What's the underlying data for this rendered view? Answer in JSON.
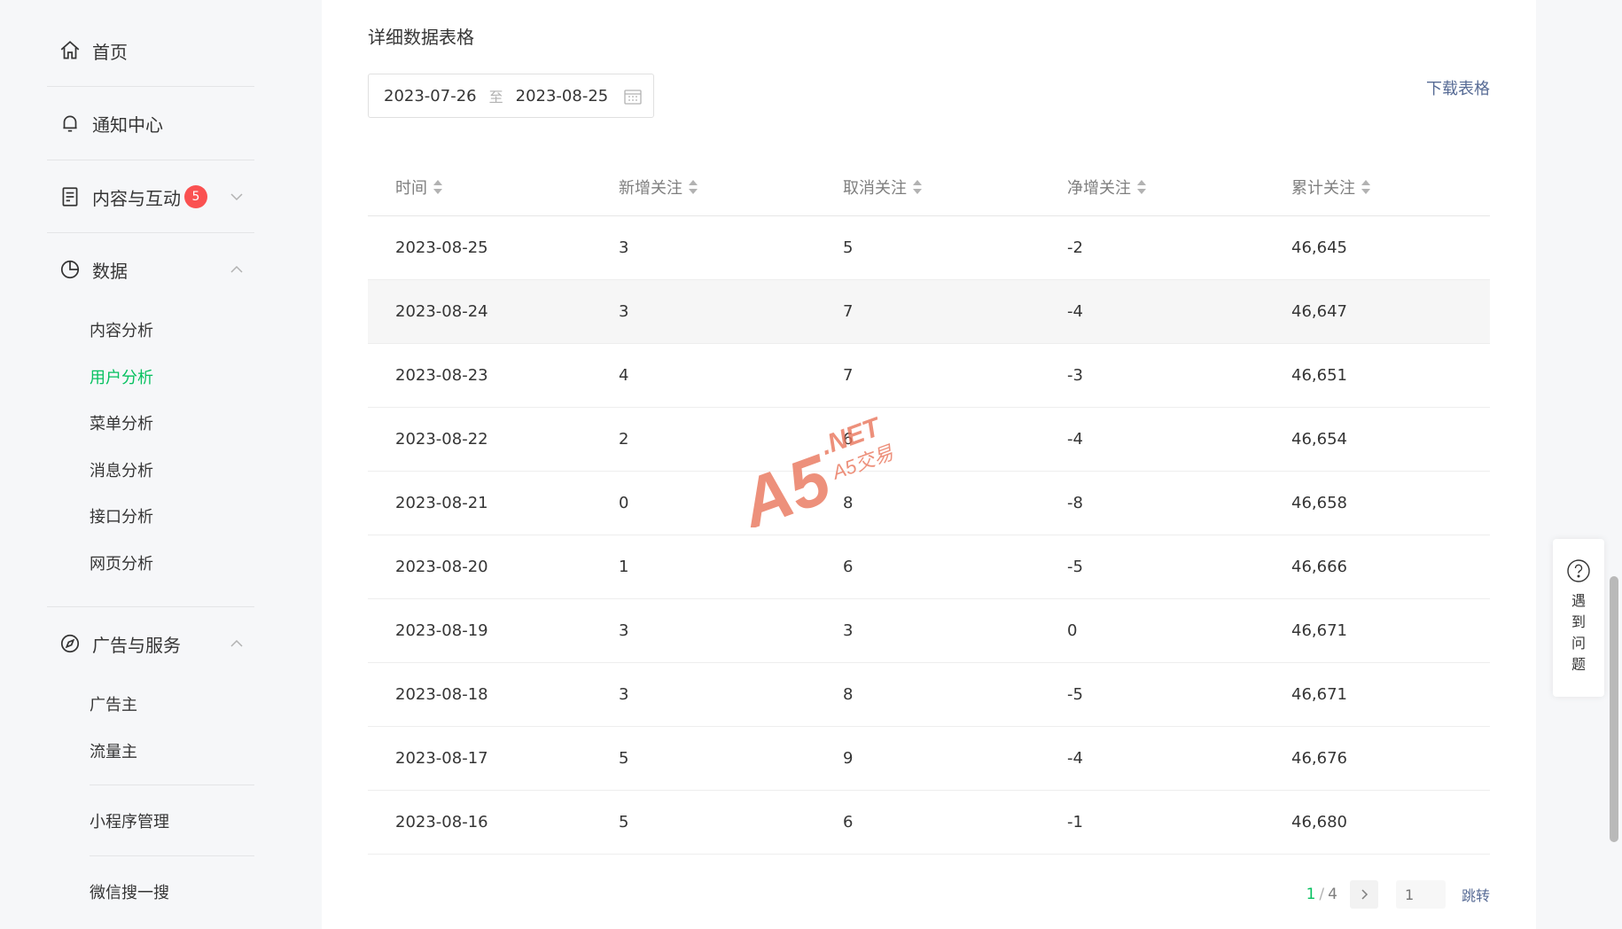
{
  "sidebar": {
    "home": "首页",
    "notifications": "通知中心",
    "content": {
      "label": "内容与互动",
      "badge": "5"
    },
    "data": {
      "label": "数据",
      "children": [
        "内容分析",
        "用户分析",
        "菜单分析",
        "消息分析",
        "接口分析",
        "网页分析"
      ]
    },
    "ads": {
      "label": "广告与服务",
      "children": [
        "广告主",
        "流量主"
      ]
    },
    "mini_program": "小程序管理",
    "wechat_search": "微信搜一搜"
  },
  "main": {
    "section_title": "详细数据表格",
    "date_range": {
      "start": "2023-07-26",
      "separator": "至",
      "end": "2023-08-25"
    },
    "download_label": "下载表格",
    "table": {
      "headers": [
        "时间",
        "新增关注",
        "取消关注",
        "净增关注",
        "累计关注"
      ],
      "rows": [
        [
          "2023-08-25",
          "3",
          "5",
          "-2",
          "46,645"
        ],
        [
          "2023-08-24",
          "3",
          "7",
          "-4",
          "46,647"
        ],
        [
          "2023-08-23",
          "4",
          "7",
          "-3",
          "46,651"
        ],
        [
          "2023-08-22",
          "2",
          "6",
          "-4",
          "46,654"
        ],
        [
          "2023-08-21",
          "0",
          "8",
          "-8",
          "46,658"
        ],
        [
          "2023-08-20",
          "1",
          "6",
          "-5",
          "46,666"
        ],
        [
          "2023-08-19",
          "3",
          "3",
          "0",
          "46,671"
        ],
        [
          "2023-08-18",
          "3",
          "8",
          "-5",
          "46,671"
        ],
        [
          "2023-08-17",
          "5",
          "9",
          "-4",
          "46,676"
        ],
        [
          "2023-08-16",
          "5",
          "6",
          "-1",
          "46,680"
        ]
      ]
    },
    "pagination": {
      "current": "1",
      "separator": "/",
      "total": "4",
      "jump_placeholder": "1",
      "jump_label": "跳转"
    }
  },
  "help": {
    "label": "遇到问题"
  },
  "watermark": {
    "brand": "A5",
    "domain": ".NET",
    "subtitle": "A5交易"
  },
  "colors": {
    "accent": "#07c160",
    "link": "#576b95",
    "badge": "#fa5151",
    "watermark": "#e8745a"
  }
}
